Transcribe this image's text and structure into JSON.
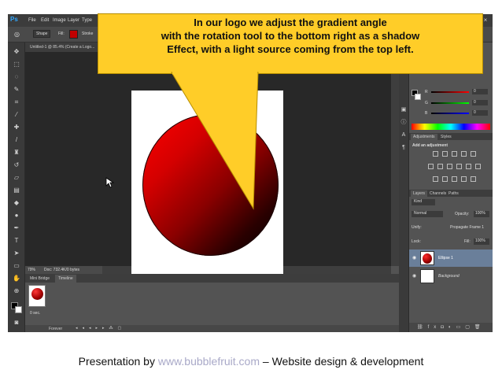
{
  "app": {
    "logo": "Ps"
  },
  "menu": [
    "File",
    "Edit",
    "Image",
    "Layer",
    "Type"
  ],
  "options_bar": {
    "mode": "Shape",
    "fill_label": "Fill:",
    "stroke_label": "Stroke"
  },
  "document": {
    "tab_title": "Untitled-1 @ 85.4% (Create a Logo..."
  },
  "status": {
    "zoom": "79%",
    "doc_size": "Doc: 732.4K/0 bytes"
  },
  "timeline": {
    "tabs": [
      "Mini Bridge",
      "Timeline"
    ],
    "frame_time": "0 sec.",
    "loop": "Forever"
  },
  "color_panel": {
    "channels": [
      "R",
      "G",
      "B"
    ],
    "values": [
      "0",
      "0",
      "0"
    ]
  },
  "adjustments": {
    "tabs": [
      "Adjustments",
      "Styles"
    ],
    "hint": "Add an adjustment"
  },
  "layers_panel": {
    "tabs": [
      "Layers",
      "Channels",
      "Paths"
    ],
    "kind": "Kind",
    "blend": "Normal",
    "opacity_label": "Opacity:",
    "opacity": "100%",
    "unify_label": "Unify:",
    "propagate": "Propagate Frame 1",
    "lock_label": "Lock:",
    "fill_label": "Fill:",
    "fill": "100%",
    "layers": [
      {
        "name": "Ellipse 1",
        "selected": true
      },
      {
        "name": "Background",
        "selected": false
      }
    ]
  },
  "callout": {
    "lines": [
      "In our logo we adjust the gradient angle",
      "with the rotation tool to the bottom right as a shadow",
      "Effect, with a light source coming from the top left."
    ]
  },
  "footer": {
    "prefix": "Presentation by ",
    "link": "www.bubblefruit.com",
    "suffix": " – Website design & development"
  },
  "colors": {
    "callout": "#ffcd28",
    "ps_bg": "#535353",
    "accent": "#c00000"
  }
}
